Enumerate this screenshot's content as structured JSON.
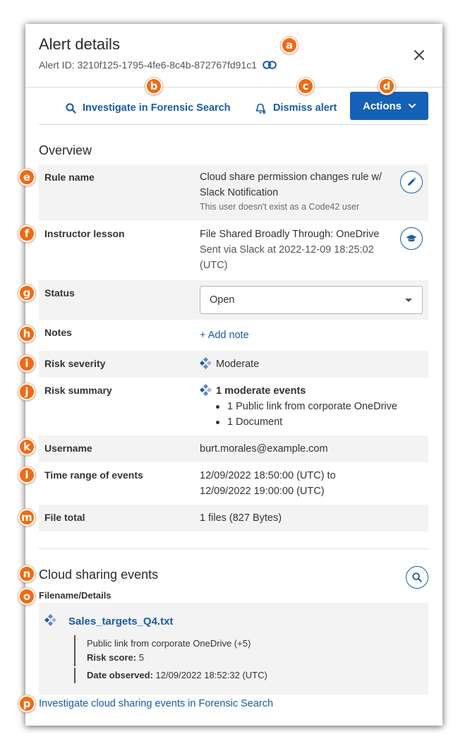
{
  "header": {
    "title": "Alert details",
    "alert_id": "Alert ID: 3210f125-1795-4fe6-8c4b-872767fd91c1"
  },
  "toolbar": {
    "investigate_label": "Investigate in Forensic Search",
    "dismiss_label": "Dismiss alert",
    "actions_label": "Actions"
  },
  "overview": {
    "title": "Overview",
    "rule_name": {
      "label": "Rule name",
      "value_line1": "Cloud share permission changes rule w/",
      "value_line2": "Slack Notification",
      "note": "This user doesn't exist as a Code42 user"
    },
    "instructor_lesson": {
      "label": "Instructor lesson",
      "value": "File Shared Broadly Through: OneDrive",
      "sent_line1": "Sent via Slack at 2022-12-09 18:25:02",
      "sent_line2": "(UTC)"
    },
    "status": {
      "label": "Status",
      "selected": "Open"
    },
    "notes": {
      "label": "Notes",
      "add_label": "+ Add note"
    },
    "risk_severity": {
      "label": "Risk severity",
      "value": "Moderate"
    },
    "risk_summary": {
      "label": "Risk summary",
      "headline": "1 moderate events",
      "items": [
        "1 Public link from corporate OneDrive",
        "1 Document"
      ]
    },
    "username": {
      "label": "Username",
      "value": "burt.morales@example.com"
    },
    "time_range": {
      "label": "Time range of events",
      "line1": "12/09/2022 18:50:00 (UTC) to",
      "line2": "12/09/2022 19:00:00 (UTC)"
    },
    "file_total": {
      "label": "File total",
      "value": "1 files (827 Bytes)"
    }
  },
  "cloud_sharing": {
    "title": "Cloud sharing events",
    "column_header": "Filename/Details",
    "file": {
      "name": "Sales_targets_Q4.txt",
      "description": "Public link from corporate OneDrive (+5)",
      "risk_score_label": "Risk score:",
      "risk_score_value": "5",
      "date_label": "Date observed:",
      "date_value": "12/09/2022 18:52:32 (UTC)"
    },
    "investigate_link": "Investigate cloud sharing events in Forensic Search"
  },
  "callouts": [
    "a",
    "b",
    "c",
    "d",
    "e",
    "f",
    "g",
    "h",
    "i",
    "j",
    "k",
    "l",
    "m",
    "n",
    "o",
    "p"
  ],
  "colors": {
    "accent": "#1561b7",
    "link": "#1a5ba6",
    "callout": "#f06a12",
    "row_shade": "#f3f3f3"
  },
  "icons": {
    "copy_link": "link-icon",
    "close": "close-icon",
    "search": "search-icon",
    "dismiss": "bell-off-icon",
    "actions_caret": "chevron-down-icon",
    "edit": "pencil-icon",
    "lesson": "graduation-cap-icon",
    "severity": "diamond-cluster-icon"
  }
}
